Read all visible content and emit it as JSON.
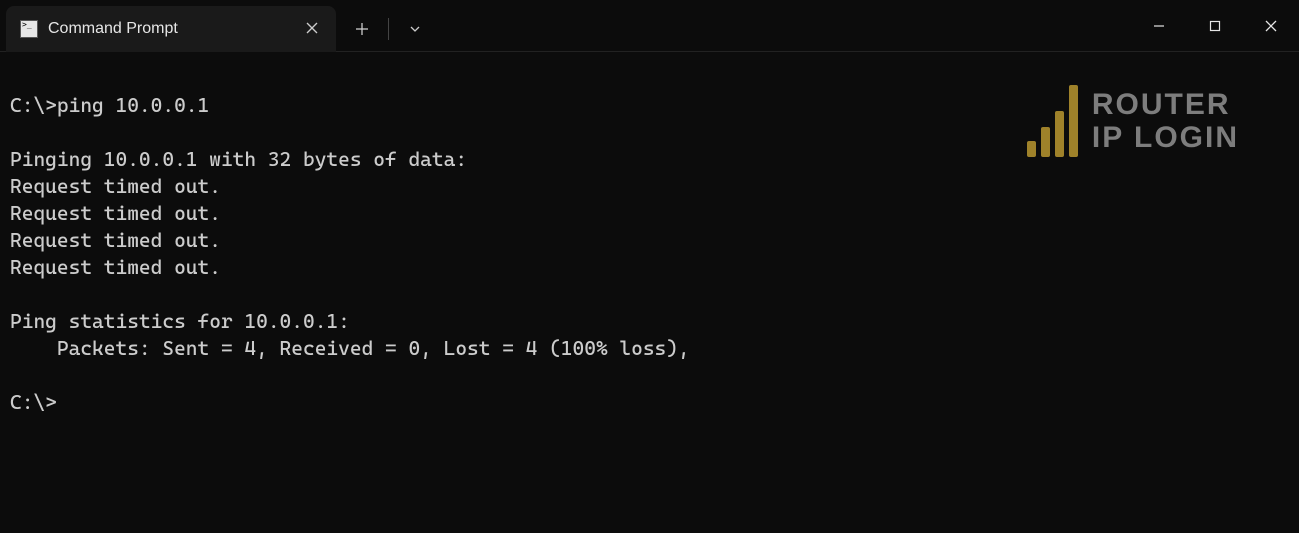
{
  "tab": {
    "title": "Command Prompt"
  },
  "terminal": {
    "line1": "C:\\>ping 10.0.0.1",
    "line2": "",
    "line3": "Pinging 10.0.0.1 with 32 bytes of data:",
    "line4": "Request timed out.",
    "line5": "Request timed out.",
    "line6": "Request timed out.",
    "line7": "Request timed out.",
    "line8": "",
    "line9": "Ping statistics for 10.0.0.1:",
    "line10": "    Packets: Sent = 4, Received = 0, Lost = 4 (100% loss),",
    "line11": "",
    "line12": "C:\\>"
  },
  "watermark": {
    "line1": "ROUTER",
    "line2": "IP LOGIN"
  }
}
